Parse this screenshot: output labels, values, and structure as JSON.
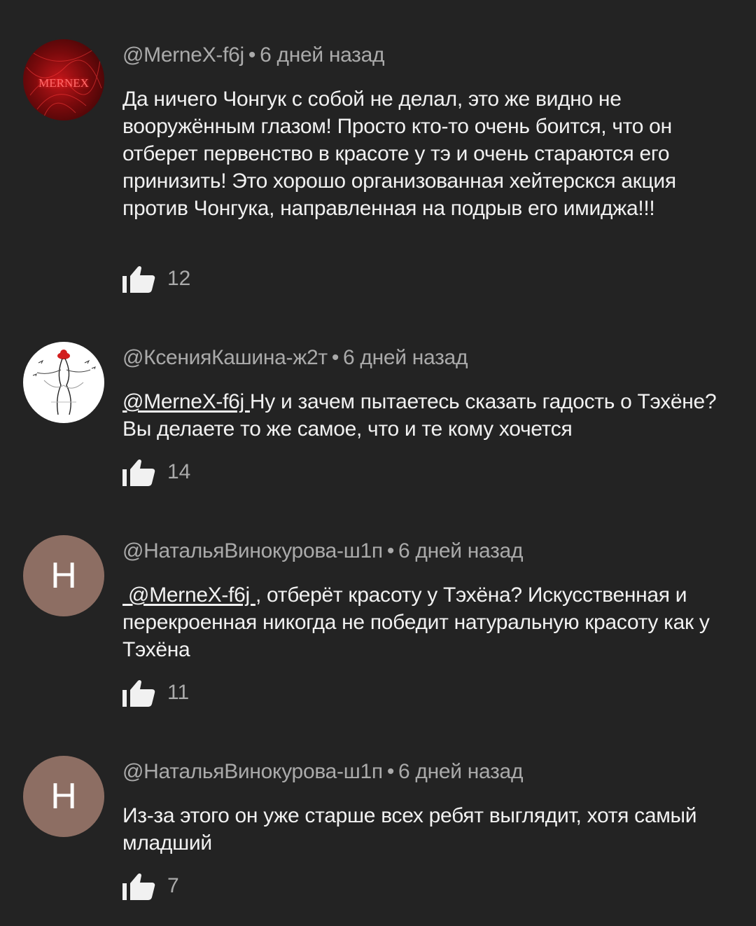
{
  "comments": [
    {
      "author": "@MerneX-f6j",
      "separator": "•",
      "time": "6 дней назад",
      "avatar": {
        "type": "image",
        "logo_text": "MERNEX"
      },
      "mention": "",
      "text": "Да ничего Чонгук с собой не делал, это же видно не вооружённым глазом! Просто кто-то очень боится, что он отберет первенство в красоте у тэ и очень стараются его принизить! Это хорошо организованная хейтерскся акция против Чонгука, направленная на подрыв его имиджа!!!",
      "likes": "12"
    },
    {
      "author": "@КсенияКашина-ж2т",
      "separator": "•",
      "time": "6 дней назад",
      "avatar": {
        "type": "image"
      },
      "mention": "@MerneX-f6j ",
      "text": "Ну и зачем пытаетесь сказать гадость о Тэхёне? Вы делаете то же самое, что и те кому хочется",
      "likes": "14"
    },
    {
      "author": "@НатальяВинокурова-ш1п",
      "separator": "•",
      "time": "6 дней назад",
      "avatar": {
        "type": "letter",
        "letter": "Н",
        "color": "#8d6e63"
      },
      "mention": " @MerneX-f6j ",
      "text": ", отберёт красоту у Тэхёна? Искусственная и перекроенная никогда не победит натуральную красоту как у Тэхёна",
      "likes": "11"
    },
    {
      "author": "@НатальяВинокурова-ш1п",
      "separator": "•",
      "time": "6 дней назад",
      "avatar": {
        "type": "letter",
        "letter": "Н",
        "color": "#8d6e63"
      },
      "mention": "",
      "text": "Из-за этого он уже старше всех ребят выглядит, хотя самый младший",
      "likes": "7"
    }
  ],
  "colors": {
    "background": "#232323",
    "text_primary": "#f1f1f1",
    "text_secondary": "#aaaaaa"
  },
  "icons": {
    "like": "thumbs-up-icon"
  }
}
